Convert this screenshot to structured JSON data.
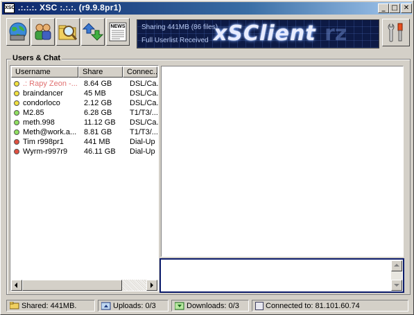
{
  "window": {
    "title": ".:.:.:. XSC :.:.:. (r9.9.8pr1)",
    "app_icon": "XSC",
    "minimize": "_",
    "maximize": "□",
    "close": "✕"
  },
  "toolbar": {
    "buttons": [
      {
        "name": "connect-globe-icon"
      },
      {
        "name": "users-icon"
      },
      {
        "name": "search-icon"
      },
      {
        "name": "transfers-icon"
      },
      {
        "name": "news-icon",
        "label": "NEWS"
      }
    ],
    "banner": {
      "status_line1": "Sharing 441MB (86 files)",
      "status_line2": "Full Userlist Received",
      "logo": "xSClient",
      "logo_ghost": "rz"
    },
    "settings_icon": "tools-icon"
  },
  "group": {
    "label": "Users & Chat"
  },
  "userlist": {
    "columns": [
      "Username",
      "Share",
      "Connec..."
    ],
    "rows": [
      {
        "status": "away",
        "color": "#f0e040",
        "username": ".: Rapy Zeon -...",
        "share": "8.64 GB",
        "conn": "DSL/Ca...",
        "highlight": true
      },
      {
        "status": "away",
        "color": "#f0e040",
        "username": "braindancer",
        "share": "45 MB",
        "conn": "DSL/Ca..."
      },
      {
        "status": "away",
        "color": "#f0e040",
        "username": "condorloco",
        "share": "2.12 GB",
        "conn": "DSL/Ca..."
      },
      {
        "status": "online",
        "color": "#90e060",
        "username": "M2.85",
        "share": "6.28 GB",
        "conn": "T1/T3/..."
      },
      {
        "status": "online",
        "color": "#90e060",
        "username": "meth.998",
        "share": "11.12 GB",
        "conn": "DSL/Ca..."
      },
      {
        "status": "online",
        "color": "#90e060",
        "username": "Meth@work.a...",
        "share": "8.81 GB",
        "conn": "T1/T3/..."
      },
      {
        "status": "op",
        "color": "#e05040",
        "username": "Tim r998pr1",
        "share": "441 MB",
        "conn": "Dial-Up"
      },
      {
        "status": "op",
        "color": "#e05040",
        "username": "Wyrm-r997r9",
        "share": "46.11 GB",
        "conn": "Dial-Up"
      }
    ]
  },
  "statusbar": {
    "shared": "Shared: 441MB.",
    "uploads": "Uploads: 0/3",
    "downloads": "Downloads: 0/3",
    "connected": "Connected to: 81.101.60.74"
  },
  "colors": {
    "highlight_user": "#e07070",
    "titlebar_start": "#0a246a",
    "titlebar_end": "#a6caf0",
    "chat_input_border": "#0a1a6a"
  }
}
